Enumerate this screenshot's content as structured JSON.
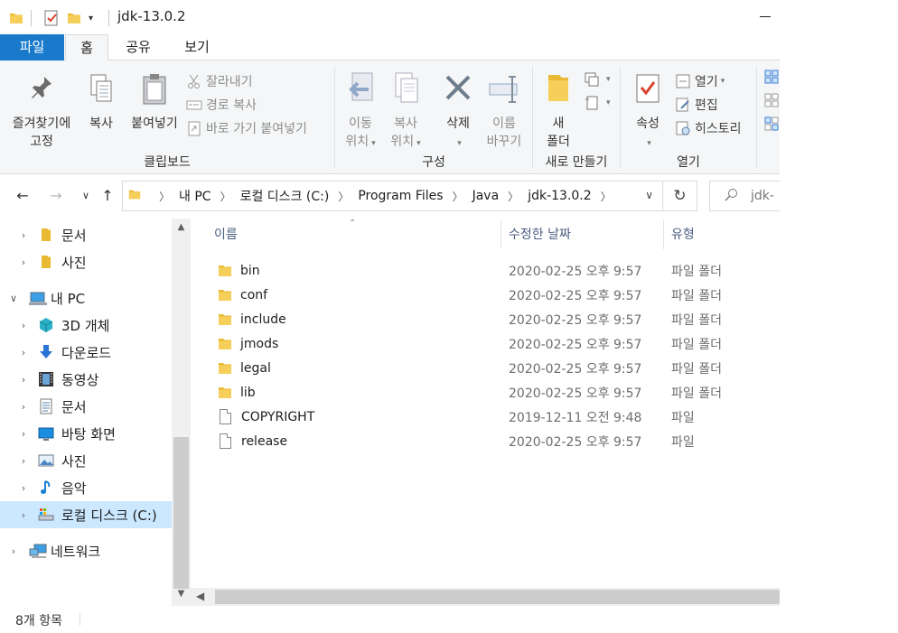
{
  "window": {
    "title": "jdk-13.0.2"
  },
  "colors": {
    "accent": "#1979ca",
    "folder": "#e8b931",
    "selection": "#cce8ff"
  },
  "tabs": [
    {
      "label": "파일"
    },
    {
      "label": "홈"
    },
    {
      "label": "공유"
    },
    {
      "label": "보기"
    }
  ],
  "ribbon": {
    "clipboard": {
      "label": "클립보드",
      "pin_line1": "즐겨찾기에",
      "pin_line2": "고정",
      "copy": "복사",
      "paste": "붙여넣기",
      "cut": "잘라내기",
      "copy_path": "경로 복사",
      "paste_shortcut": "바로 가기 붙여넣기"
    },
    "organize": {
      "label": "구성",
      "move_line1": "이동",
      "move_line2": "위치",
      "copyto_line1": "복사",
      "copyto_line2": "위치",
      "delete": "삭제",
      "rename_line1": "이름",
      "rename_line2": "바꾸기"
    },
    "new": {
      "label": "새로 만들기",
      "folder_line1": "새",
      "folder_line2": "폴더"
    },
    "open": {
      "label": "열기",
      "properties": "속성",
      "open": "열기",
      "edit": "편집",
      "history": "히스토리"
    }
  },
  "address": {
    "crumbs": [
      "내 PC",
      "로컬 디스크 (C:)",
      "Program Files",
      "Java",
      "jdk-13.0.2"
    ],
    "search_placeholder": "jdk-"
  },
  "navpane": {
    "items": [
      {
        "label": "문서",
        "icon": "folder-icon",
        "indent": 1
      },
      {
        "label": "사진",
        "icon": "folder-icon",
        "indent": 1
      },
      {
        "label": "내 PC",
        "icon": "computer-icon",
        "indent": 0,
        "expanded": true
      },
      {
        "label": "3D 개체",
        "icon": "3d-objects-icon",
        "indent": 1
      },
      {
        "label": "다운로드",
        "icon": "download-icon",
        "indent": 1
      },
      {
        "label": "동영상",
        "icon": "video-icon",
        "indent": 1
      },
      {
        "label": "문서",
        "icon": "documents-icon",
        "indent": 1
      },
      {
        "label": "바탕 화면",
        "icon": "desktop-icon",
        "indent": 1
      },
      {
        "label": "사진",
        "icon": "pictures-icon",
        "indent": 1
      },
      {
        "label": "음악",
        "icon": "music-icon",
        "indent": 1
      },
      {
        "label": "로컬 디스크 (C:)",
        "icon": "drive-icon",
        "indent": 1,
        "selected": true
      },
      {
        "label": "네트워크",
        "icon": "network-icon",
        "indent": 0
      }
    ]
  },
  "filelist": {
    "columns": {
      "name": "이름",
      "date": "수정한 날짜",
      "type": "유형"
    },
    "rows": [
      {
        "name": "bin",
        "date": "2020-02-25 오후 9:57",
        "type": "파일 폴더",
        "kind": "folder"
      },
      {
        "name": "conf",
        "date": "2020-02-25 오후 9:57",
        "type": "파일 폴더",
        "kind": "folder"
      },
      {
        "name": "include",
        "date": "2020-02-25 오후 9:57",
        "type": "파일 폴더",
        "kind": "folder"
      },
      {
        "name": "jmods",
        "date": "2020-02-25 오후 9:57",
        "type": "파일 폴더",
        "kind": "folder"
      },
      {
        "name": "legal",
        "date": "2020-02-25 오후 9:57",
        "type": "파일 폴더",
        "kind": "folder"
      },
      {
        "name": "lib",
        "date": "2020-02-25 오후 9:57",
        "type": "파일 폴더",
        "kind": "folder"
      },
      {
        "name": "COPYRIGHT",
        "date": "2019-12-11 오전 9:48",
        "type": "파일",
        "kind": "file"
      },
      {
        "name": "release",
        "date": "2020-02-25 오후 9:57",
        "type": "파일",
        "kind": "file"
      }
    ]
  },
  "status": {
    "count": "8개 항목"
  }
}
